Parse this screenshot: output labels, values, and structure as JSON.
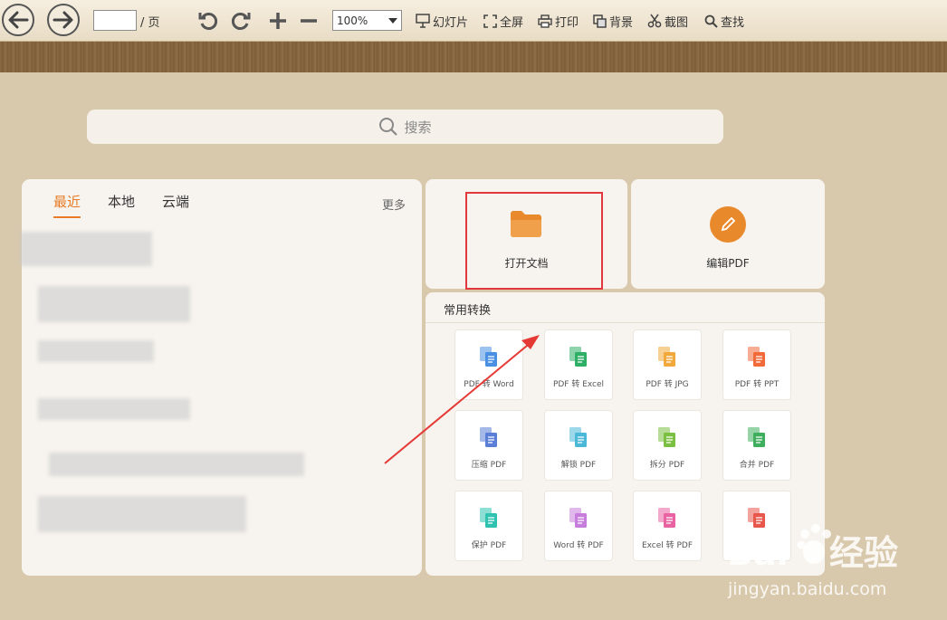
{
  "toolbar": {
    "page_value": "",
    "page_suffix": "/ 页",
    "zoom": "100%",
    "tools": [
      {
        "label": "幻灯片",
        "icon": "slideshow-icon"
      },
      {
        "label": "全屏",
        "icon": "fullscreen-icon"
      },
      {
        "label": "打印",
        "icon": "print-icon"
      },
      {
        "label": "背景",
        "icon": "background-icon"
      },
      {
        "label": "截图",
        "icon": "scissors-icon"
      },
      {
        "label": "查找",
        "icon": "search-icon"
      }
    ]
  },
  "search": {
    "placeholder": "搜索"
  },
  "recent": {
    "tabs": [
      "最近",
      "本地",
      "云端"
    ],
    "active_tab": "最近",
    "more": "更多"
  },
  "actions": {
    "open": "打开文档",
    "edit": "编辑PDF"
  },
  "conversions": {
    "title": "常用转换",
    "items": [
      {
        "label": "PDF 转 Word",
        "color": "#4a90e2"
      },
      {
        "label": "PDF 转 Excel",
        "color": "#2fae66"
      },
      {
        "label": "PDF 转 JPG",
        "color": "#f1a93c"
      },
      {
        "label": "PDF 转 PPT",
        "color": "#f06a3a"
      },
      {
        "label": "压缩 PDF",
        "color": "#5b7fd6"
      },
      {
        "label": "解锁 PDF",
        "color": "#4cb8d8"
      },
      {
        "label": "拆分 PDF",
        "color": "#7bc043"
      },
      {
        "label": "合并 PDF",
        "color": "#3fae5f"
      },
      {
        "label": "保护 PDF",
        "color": "#2fc2b0"
      },
      {
        "label": "Word 转 PDF",
        "color": "#c77ddb"
      },
      {
        "label": "Excel 转 PDF",
        "color": "#e963a3"
      },
      {
        "label": "",
        "color": "#e8574c"
      }
    ]
  },
  "watermark": {
    "text": "jingyan.baidu.com",
    "logo": "Baidu经验"
  },
  "colors": {
    "accent": "#e77b27",
    "highlight": "#e0383d"
  }
}
